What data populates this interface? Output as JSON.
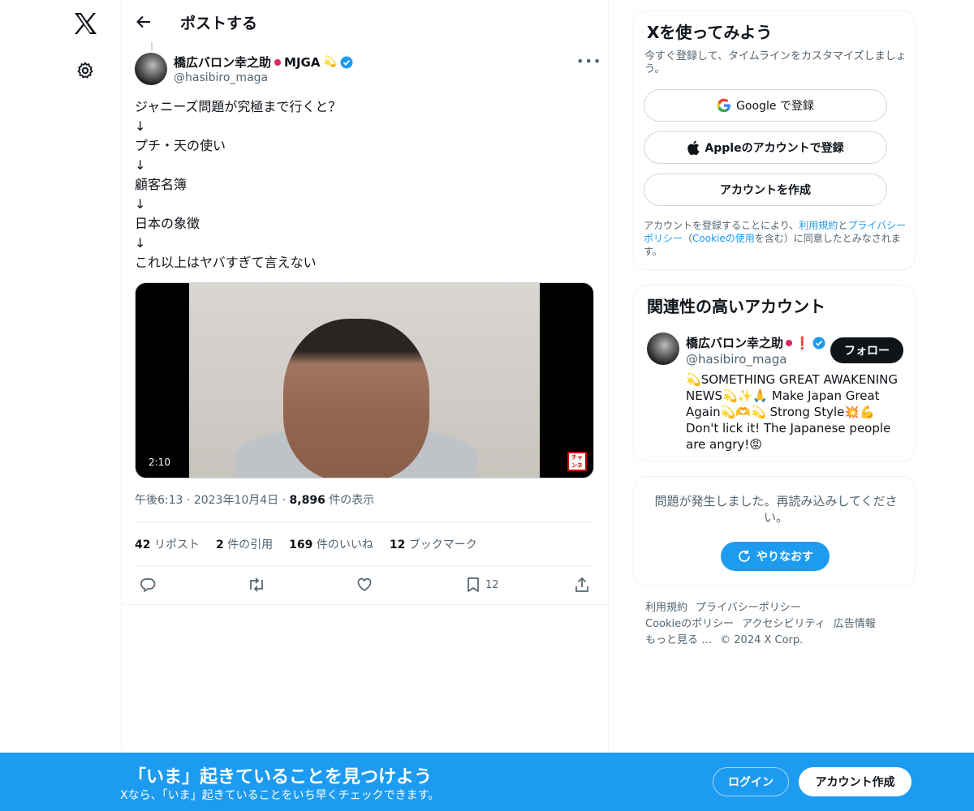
{
  "header": {
    "title": "ポストする"
  },
  "post": {
    "author_name": "橋広バロン幸之助",
    "author_suffix": "MJGA",
    "author_handle": "@hasibiro_maga",
    "more": "•••",
    "lines": [
      "ジャニーズ問題が究極まで行くと？",
      "↓",
      "プチ・天の使い",
      "↓",
      "顧客名簿",
      "↓",
      "日本の象徴",
      "↓",
      "これ以上はヤバすぎて言えない"
    ],
    "video_duration": "2:10",
    "channel_logo": "チャンネル登録",
    "time": "午後6:13",
    "date": "2023年10月4日",
    "views": "8,896",
    "views_label": "件の表示",
    "stats": {
      "reposts": "42",
      "reposts_label": "リポスト",
      "quotes": "2",
      "quotes_label": "件の引用",
      "likes": "169",
      "likes_label": "件のいいね",
      "bookmarks": "12",
      "bookmarks_label": "ブックマーク"
    },
    "bookmark_count": "12"
  },
  "signup_card": {
    "title": "Xを使ってみよう",
    "subtitle": "今すぐ登録して、タイムラインをカスタマイズしましょう。",
    "google_label": "Google で登録",
    "apple_label": "Appleのアカウントで登録",
    "create_label": "アカウントを作成",
    "terms_prefix": "アカウントを登録することにより、",
    "terms_link": "利用規約",
    "terms_and": "と",
    "privacy_link": "プライバシーポリシー",
    "terms_paren_open": "（",
    "cookie_link": "Cookieの使用",
    "terms_suffix": "を含む）に同意したとみなされます。"
  },
  "related": {
    "title": "関連性の高いアカウント",
    "name": "橋広バロン幸之助",
    "handle": "@hasibiro_maga",
    "follow_label": "フォロー",
    "bio_1": "SOMETHING GREAT AWAKENING NEWS",
    "bio_2": "Make Japan Great Again",
    "bio_3": "Strong Style",
    "bio_4": "Don't lick it! The Japanese people are angry!"
  },
  "error_card": {
    "message": "問題が発生しました。再読み込みしてください。",
    "retry_label": "やりなおす"
  },
  "footer": {
    "links": [
      "利用規約",
      "プライバシーポリシー",
      "Cookieのポリシー",
      "アクセシビリティ",
      "広告情報",
      "もっと見る …"
    ],
    "copyright": "© 2024 X Corp."
  },
  "bottom_bar": {
    "title": "「いま」起きていることを見つけよう",
    "subtitle": "Xなら、「いま」起きていることをいち早くチェックできます。",
    "login_label": "ログイン",
    "signup_label": "アカウント作成"
  },
  "icons": [
    "x-logo-icon",
    "gear-icon",
    "back-arrow-icon",
    "verified-badge-icon",
    "reply-icon",
    "repost-icon",
    "like-icon",
    "bookmark-icon",
    "share-icon",
    "google-icon",
    "apple-icon",
    "refresh-icon"
  ],
  "colors": {
    "accent": "#1d9bf0",
    "text": "#0f1419",
    "muted": "#536471",
    "border": "#eff3f4"
  }
}
